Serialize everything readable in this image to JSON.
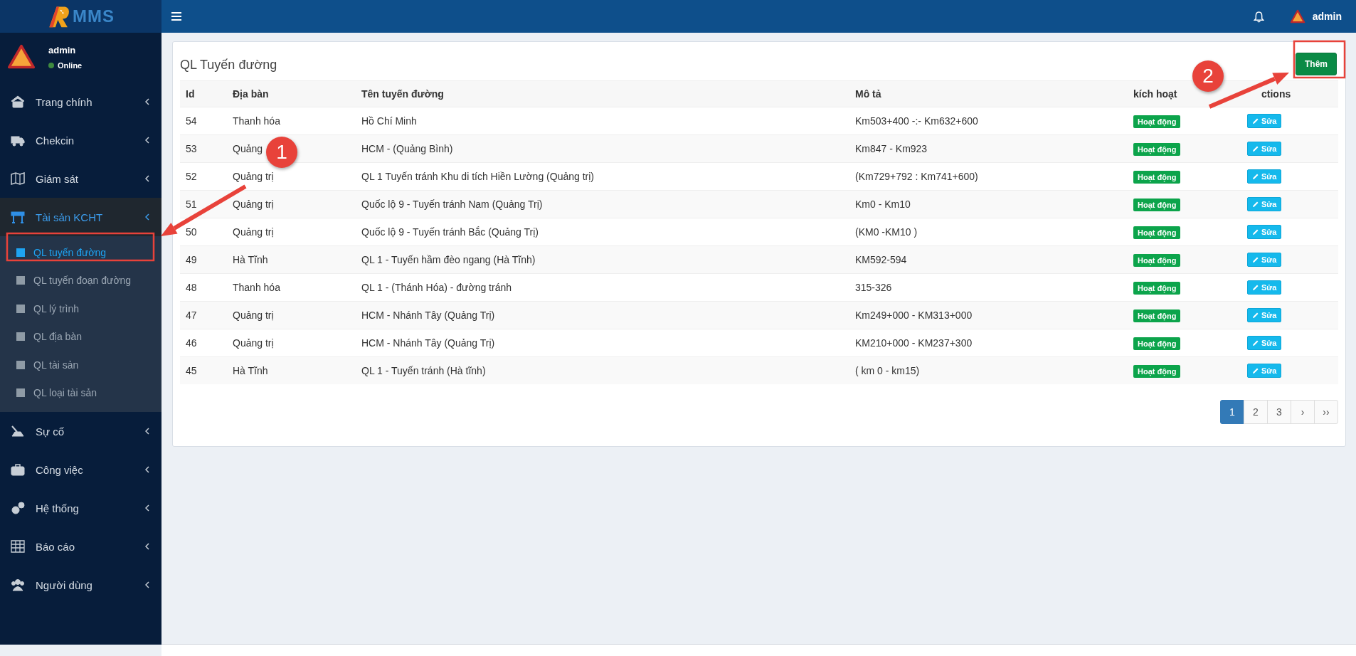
{
  "header": {
    "logo_text": "MMS",
    "user_name": "admin"
  },
  "sidebar": {
    "user": {
      "name": "admin",
      "status": "Online"
    },
    "menu": [
      {
        "label": "Trang chính",
        "expanded": false
      },
      {
        "label": "Chekcin",
        "expanded": false
      },
      {
        "label": "Giám sát",
        "expanded": false
      },
      {
        "label": "Tài sản KCHT",
        "expanded": true,
        "children": [
          {
            "label": "QL tuyến đường",
            "selected": true
          },
          {
            "label": "QL tuyến đoạn đường",
            "selected": false
          },
          {
            "label": "QL lý trình",
            "selected": false
          },
          {
            "label": "QL địa bàn",
            "selected": false
          },
          {
            "label": "QL tài sản",
            "selected": false
          },
          {
            "label": "QL loại tài sản",
            "selected": false
          }
        ]
      },
      {
        "label": "Sự cố",
        "expanded": false
      },
      {
        "label": "Công việc",
        "expanded": false
      },
      {
        "label": "Hệ thống",
        "expanded": false
      },
      {
        "label": "Báo cáo",
        "expanded": false
      },
      {
        "label": "Người dùng",
        "expanded": false
      }
    ]
  },
  "panel": {
    "title": "QL Tuyến đường",
    "add_button": "Thêm"
  },
  "table": {
    "columns": [
      "Id",
      "Địa bàn",
      "Tên tuyến đường",
      "Mô tả",
      "kích hoạt",
      "ctions"
    ],
    "rows": [
      {
        "id": "54",
        "area": "Thanh hóa",
        "name": "Hồ Chí Minh",
        "desc": "Km503+400 -:- Km632+600",
        "status": "Hoạt động",
        "action": "Sửa"
      },
      {
        "id": "53",
        "area": "Quảng",
        "name": "HCM - (Quảng Bình)",
        "desc": "Km847 - Km923",
        "status": "Hoạt động",
        "action": "Sửa"
      },
      {
        "id": "52",
        "area": "Quảng trị",
        "name": "QL 1 Tuyến tránh Khu di tích Hiền Lường (Quảng trị)",
        "desc": "(Km729+792 : Km741+600)",
        "status": "Hoạt động",
        "action": "Sửa"
      },
      {
        "id": "51",
        "area": "Quảng trị",
        "name": "Quốc lộ 9 - Tuyến tránh Nam (Quảng Trị)",
        "desc": "Km0 - Km10",
        "status": "Hoạt động",
        "action": "Sửa"
      },
      {
        "id": "50",
        "area": "Quảng trị",
        "name": "Quốc lộ 9 - Tuyến tránh Bắc (Quảng Trị)",
        "desc": "(KM0 -KM10 )",
        "status": "Hoạt động",
        "action": "Sửa"
      },
      {
        "id": "49",
        "area": "Hà Tĩnh",
        "name": "QL 1 - Tuyến hầm đèo ngang (Hà Tĩnh)",
        "desc": "KM592-594",
        "status": "Hoạt động",
        "action": "Sửa"
      },
      {
        "id": "48",
        "area": "Thanh hóa",
        "name": "QL 1 - (Thánh Hóa) - đường tránh",
        "desc": "315-326",
        "status": "Hoạt động",
        "action": "Sửa"
      },
      {
        "id": "47",
        "area": "Quảng trị",
        "name": "HCM - Nhánh Tây (Quảng Trị)",
        "desc": "Km249+000 - KM313+000",
        "status": "Hoạt động",
        "action": "Sửa"
      },
      {
        "id": "46",
        "area": "Quảng trị",
        "name": "HCM - Nhánh Tây (Quảng Trị)",
        "desc": "KM210+000 - KM237+300",
        "status": "Hoạt động",
        "action": "Sửa"
      },
      {
        "id": "45",
        "area": "Hà Tĩnh",
        "name": "QL 1 - Tuyến tránh (Hà tĩnh)",
        "desc": "( km 0 - km15)",
        "status": "Hoạt động",
        "action": "Sửa"
      }
    ]
  },
  "pagination": [
    {
      "label": "1",
      "selected": true
    },
    {
      "label": "2",
      "selected": false
    },
    {
      "label": "3",
      "selected": false
    },
    {
      "label": "›",
      "selected": false
    },
    {
      "label": "››",
      "selected": false
    }
  ],
  "annotations": [
    {
      "number": "1"
    },
    {
      "number": "2"
    }
  ]
}
